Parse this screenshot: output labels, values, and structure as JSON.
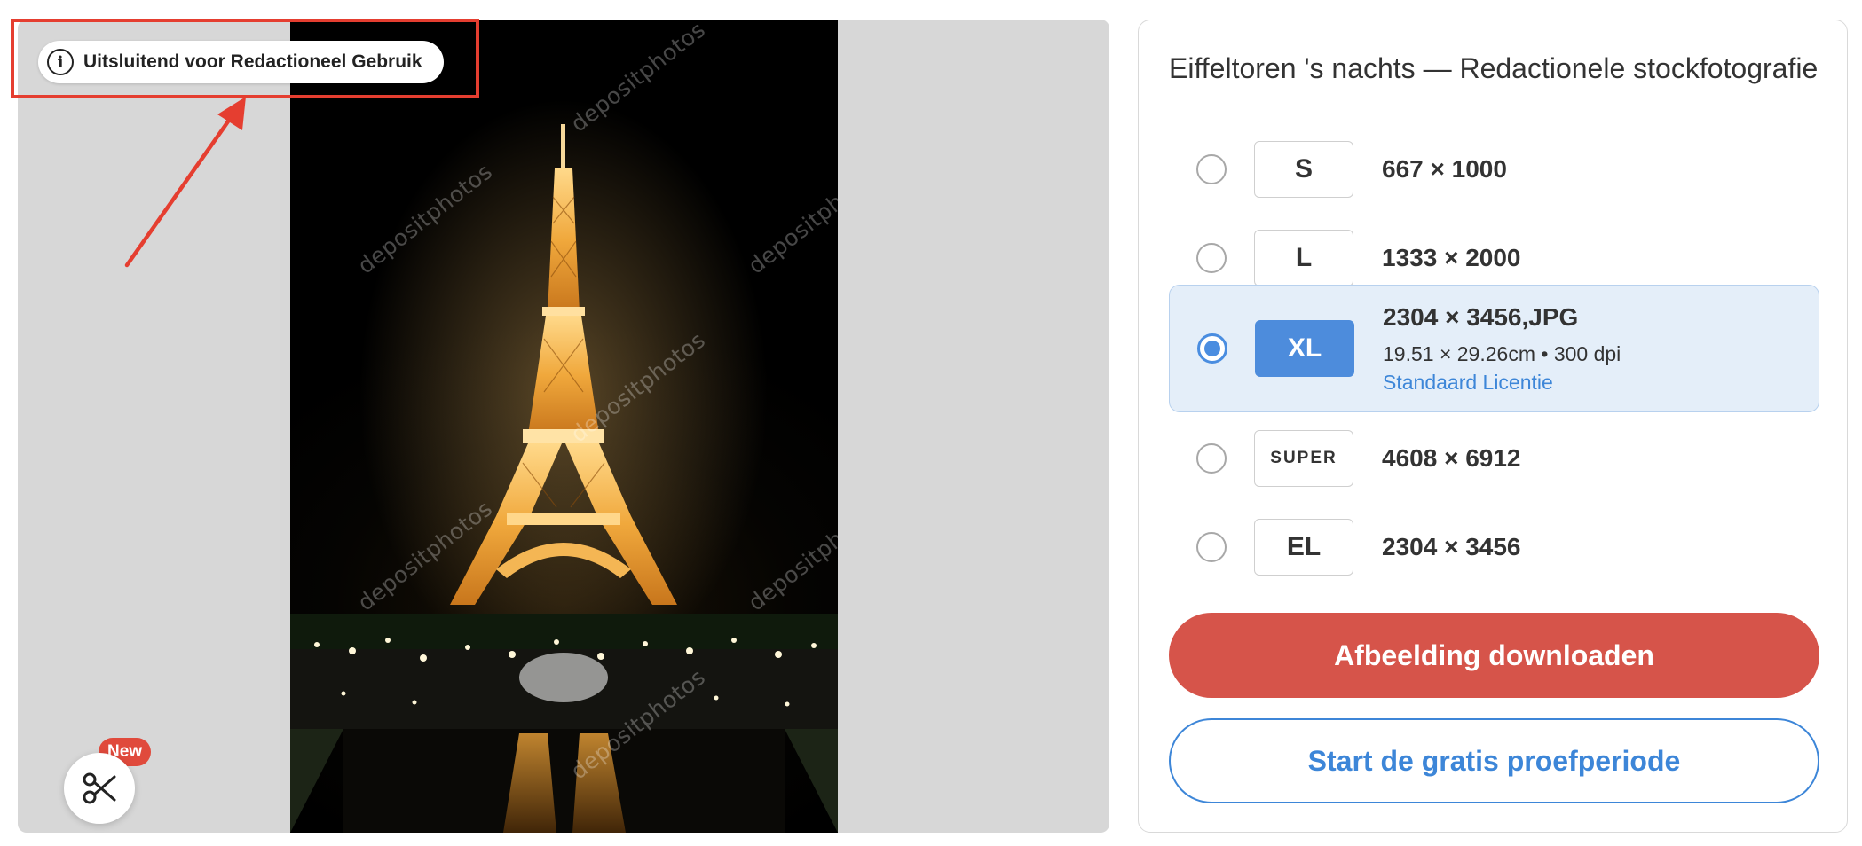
{
  "preview": {
    "editorial_label": "Uitsluitend voor Redactioneel Gebruik",
    "watermark_text": "depositphotos",
    "tool_icon": "scissors-icon",
    "new_badge": "New"
  },
  "options": {
    "title": "Eiffeltoren 's nachts — Redactionele stockfotografie",
    "sizes": [
      {
        "label": "S",
        "dimensions": "667 × 1000",
        "selected": false
      },
      {
        "label": "L",
        "dimensions": "1333 × 2000",
        "selected": false
      },
      {
        "label": "XL",
        "dimensions": "2304 × 3456,JPG",
        "detail": "19.51 × 29.26cm • 300 dpi",
        "license": "Standaard Licentie",
        "selected": true
      },
      {
        "label": "SUPER",
        "dimensions": "4608 × 6912",
        "selected": false
      },
      {
        "label": "EL",
        "dimensions": "2304 × 3456",
        "selected": false
      }
    ],
    "download_label": "Afbeelding downloaden",
    "trial_label": "Start de gratis proefperiode"
  },
  "colors": {
    "accent_blue": "#4d8cdc",
    "download_red": "#d6544a",
    "annotation_red": "#e53e30",
    "selected_bg": "#e4eef9"
  }
}
